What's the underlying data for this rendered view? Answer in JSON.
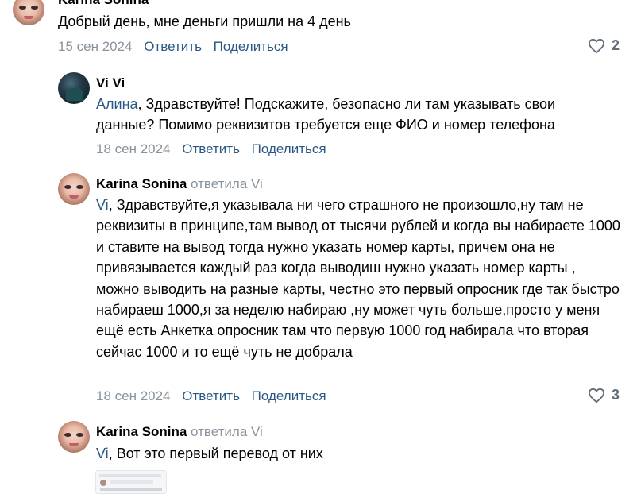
{
  "comments": [
    {
      "author": "Karina Sonina",
      "text": "Добрый день, мне деньги пришли на 4 день",
      "date": "15 сен 2024",
      "reply_label": "Ответить",
      "share_label": "Поделиться",
      "likes": "2"
    },
    {
      "author": "Vi Vi",
      "mention": "Алина",
      "text": ", Здравствуйте! Подскажите, безопасно ли там указывать свои данные? Помимо реквизитов требуется еще ФИО и номер телефона",
      "date": "18 сен 2024",
      "reply_label": "Ответить",
      "share_label": "Поделиться"
    },
    {
      "author": "Karina Sonina",
      "replied_to": "ответила Vi",
      "mention": "Vi",
      "text": ", Здравствуйте,я указывала ни чего страшного не произошло,ну там не реквизиты в принципе,там вывод от тысячи рублей и когда вы набираете 1000 и ставите на вывод тогда нужно указать номер карты, причем она не привязывается каждый раз когда выводиш нужно указать номер карты , можно выводить на разные карты, честно это первый опросник где так быстро набираеш 1000,я за неделю набираю ,ну может чуть больше,просто у меня ещё есть Анкетка опросник там что первую 1000 год набирала что вторая сейчас 1000 и то ещё чуть не добрала",
      "date": "18 сен 2024",
      "reply_label": "Ответить",
      "share_label": "Поделиться",
      "likes": "3"
    },
    {
      "author": "Karina Sonina",
      "replied_to": "ответила Vi",
      "mention": "Vi",
      "text": ", Вот это первый перевод от них"
    }
  ],
  "colors": {
    "link": "#2a5885",
    "muted": "#8a939c",
    "likes": "#626d7a"
  },
  "icons": [
    "heart-outline-icon"
  ]
}
